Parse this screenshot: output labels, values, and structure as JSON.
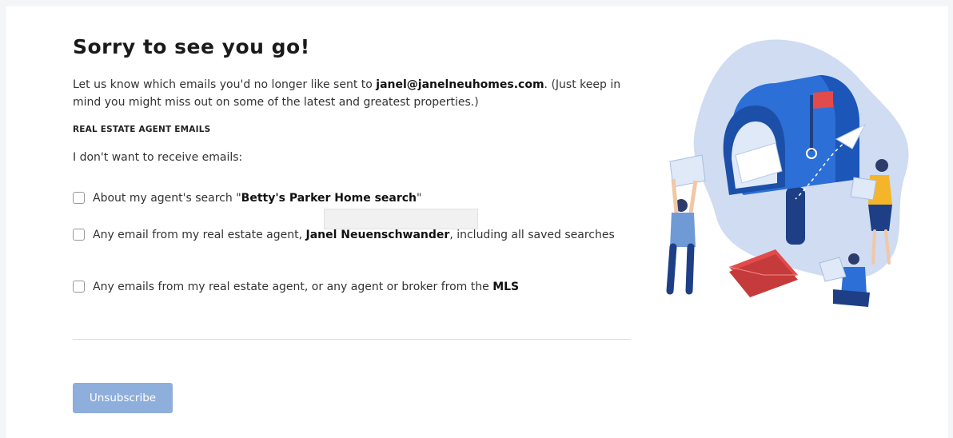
{
  "page": {
    "title": "Sorry to see you go!",
    "intro_prefix": "Let us know which emails you'd no longer like sent to ",
    "email": "janel@janelneuhomes.com",
    "intro_suffix": ". (Just keep in mind you might miss out on some of the latest and greatest properties.)",
    "section_label": "REAL ESTATE AGENT EMAILS",
    "lead": "I don't want to receive emails:"
  },
  "options": [
    {
      "prefix": "About my agent's search \"",
      "bold": "Betty's Parker Home search",
      "suffix": "\"",
      "checked": false
    },
    {
      "prefix": "Any email from my real estate agent, ",
      "bold": "Janel Neuenschwander",
      "suffix": ", including all saved searches",
      "checked": false
    },
    {
      "prefix": "Any emails from my real estate agent, or any agent or broker from the ",
      "bold": "MLS",
      "suffix": "",
      "checked": false
    }
  ],
  "actions": {
    "unsubscribe_label": "Unsubscribe"
  },
  "colors": {
    "button": "#8eaedb",
    "illustration_blob": "#cfdcf2",
    "mailbox_blue": "#2c6fd6",
    "flag_red": "#e24b4b"
  },
  "icons": {
    "illustration": "mailbox-illustration"
  }
}
